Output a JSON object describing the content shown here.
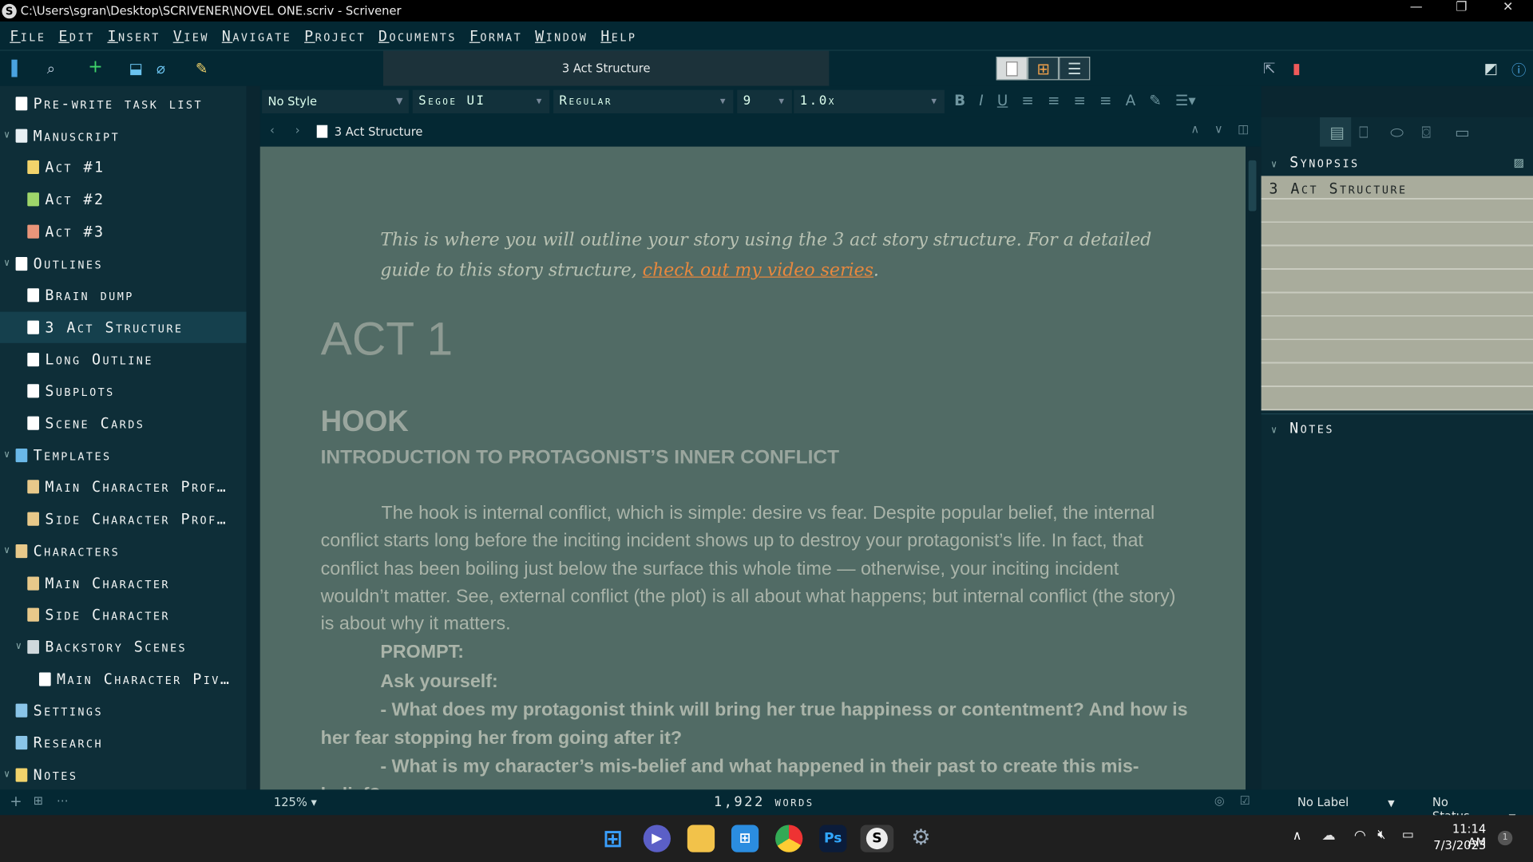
{
  "window": {
    "title": "C:\\Users\\sgran\\Desktop\\SCRIVENER\\NOVEL ONE.scriv - Scrivener",
    "minimize": "—",
    "restore": "❐",
    "close": "✕"
  },
  "menu": [
    "File",
    "Edit",
    "Insert",
    "View",
    "Navigate",
    "Project",
    "Documents",
    "Format",
    "Window",
    "Help"
  ],
  "toolbar": {
    "doc_tab": "3 Act Structure"
  },
  "binder": [
    {
      "label": "Pre-write task list",
      "level": 0,
      "icon": "checkbox-icon",
      "color": "#ffffff"
    },
    {
      "label": "Manuscript",
      "level": 0,
      "icon": "manuscript-icon",
      "color": "#e8f0f4",
      "expanded": true
    },
    {
      "label": "Act #1",
      "level": 1,
      "icon": "folder-icon",
      "color": "#f2d36b"
    },
    {
      "label": "Act #2",
      "level": 1,
      "icon": "folder-icon",
      "color": "#9ed56a"
    },
    {
      "label": "Act #3",
      "level": 1,
      "icon": "folder-icon",
      "color": "#e9957a"
    },
    {
      "label": "Outlines",
      "level": 0,
      "icon": "folder-icon",
      "color": "#ffffff",
      "expanded": true
    },
    {
      "label": "Brain dump",
      "level": 1,
      "icon": "document-icon",
      "color": "#ffffff"
    },
    {
      "label": "3 Act Structure",
      "level": 1,
      "icon": "document-icon",
      "color": "#ffffff",
      "selected": true
    },
    {
      "label": "Long Outline",
      "level": 1,
      "icon": "document-icon",
      "color": "#ffffff"
    },
    {
      "label": "Subplots",
      "level": 1,
      "icon": "document-icon",
      "color": "#ffffff"
    },
    {
      "label": "Scene Cards",
      "level": 1,
      "icon": "document-icon",
      "color": "#ffffff"
    },
    {
      "label": "Templates",
      "level": 0,
      "icon": "templates-icon",
      "color": "#6ab8e8",
      "expanded": true
    },
    {
      "label": "Main Character Prof…",
      "level": 1,
      "icon": "template-sheet-icon",
      "color": "#e8c98a"
    },
    {
      "label": "Side Character Prof…",
      "level": 1,
      "icon": "template-sheet-icon",
      "color": "#e8c98a"
    },
    {
      "label": "Characters",
      "level": 0,
      "icon": "characters-icon",
      "color": "#e8c98a",
      "expanded": true
    },
    {
      "label": "Main Character",
      "level": 1,
      "icon": "character-sheet-icon",
      "color": "#e8c98a"
    },
    {
      "label": "Side Character",
      "level": 1,
      "icon": "character-sheet-icon",
      "color": "#e8c98a"
    },
    {
      "label": "Backstory Scenes",
      "level": 1,
      "icon": "folder-icon",
      "color": "#cfd8dc",
      "expanded": true
    },
    {
      "label": "Main Character Piv…",
      "level": 2,
      "icon": "document-icon",
      "color": "#ffffff"
    },
    {
      "label": "Settings",
      "level": 0,
      "icon": "settings-icon",
      "color": "#8ac5e8"
    },
    {
      "label": "Research",
      "level": 0,
      "icon": "research-icon",
      "color": "#8ac5e8"
    },
    {
      "label": "Notes",
      "level": 0,
      "icon": "notes-icon",
      "color": "#f2d36b",
      "expanded": true
    }
  ],
  "format": {
    "style": "No Style",
    "font": "Segoe UI",
    "weight": "Regular",
    "size": "9",
    "spacing": "1.0x"
  },
  "header": {
    "doc_title": "3 Act Structure"
  },
  "document": {
    "intro_before": "This is where you will outline your story using the 3 act story structure. For a detailed guide to this story structure, ",
    "intro_link": "check out my video series",
    "intro_after": ".",
    "h1": "ACT 1",
    "h2": "HOOK",
    "h3": "INTRODUCTION TO PROTAGONIST’S INNER CONFLICT",
    "para": "The hook is internal conflict, which is simple: desire vs fear. Despite popular belief, the internal conflict starts long before the inciting incident shows up to destroy your protagonist’s life. In fact, that conflict has been boiling just below the surface this whole time — otherwise, your inciting incident wouldn’t matter. See, external conflict (the plot) is all about what happens; but internal conflict (the story) is about why it matters.",
    "prompt": "PROMPT:",
    "ask": "Ask yourself:",
    "q1": "- What does my protagonist think will bring her true happiness or contentment? And how is her fear stopping her from going after it?",
    "q2": "- What is my character’s mis-belief and what happened in their past to create this mis-belief?"
  },
  "inspector": {
    "synopsis_label": "Synopsis",
    "synopsis_title": "3 Act Structure",
    "notes_label": "Notes"
  },
  "status": {
    "zoom": "125%",
    "word_count": "1,922 words",
    "label": "No Label",
    "status": "No Status"
  },
  "taskbar": {
    "time": "11:14 AM",
    "date": "7/3/2023",
    "notification_count": "1"
  },
  "colors": {
    "editor_bg": "#516b65",
    "link": "#e8883e",
    "synopsis_card": "#a9ac9c",
    "chrome": "#042833"
  }
}
